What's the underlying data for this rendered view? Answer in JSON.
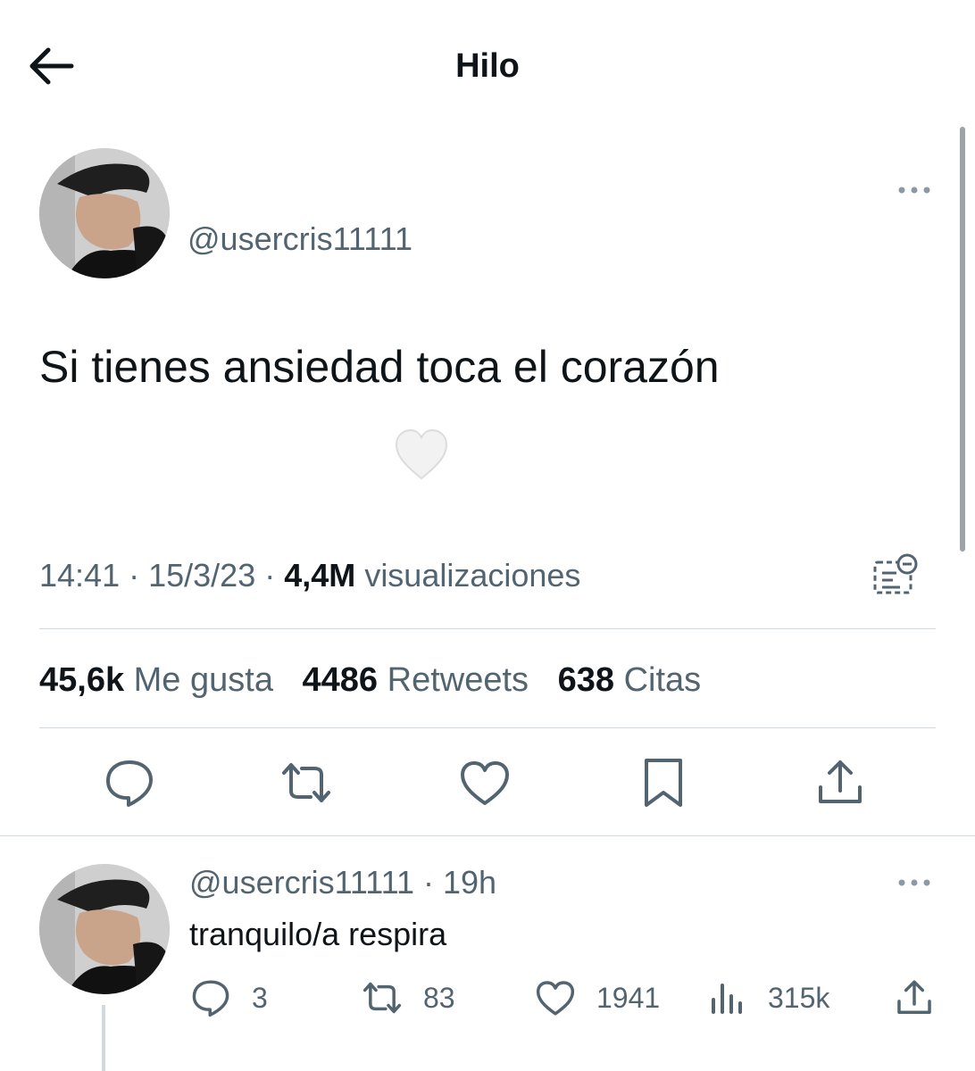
{
  "header": {
    "title": "Hilo",
    "back_icon": "arrow-left-icon"
  },
  "tweet": {
    "handle": "@usercris11111",
    "text": "Si tienes ansiedad toca el corazón",
    "emoji": "white-heart",
    "time": "14:41",
    "date": "15/3/23",
    "views_count": "4,4M",
    "views_label": "visualizaciones",
    "likes_count": "45,6k",
    "likes_label": "Me gusta",
    "retweets_count": "4486",
    "retweets_label": "Retweets",
    "quotes_count": "638",
    "quotes_label": "Citas"
  },
  "actions": [
    "reply-icon",
    "retweet-icon",
    "like-icon",
    "bookmark-icon",
    "share-icon"
  ],
  "reply": {
    "handle": "@usercris11111",
    "time": "19h",
    "text": "tranquilo/a respira",
    "replies": "3",
    "retweets": "83",
    "likes": "1941",
    "views": "315k"
  },
  "colors": {
    "text": "#0f1419",
    "secondary": "#536471",
    "divider": "#cfd9de"
  }
}
